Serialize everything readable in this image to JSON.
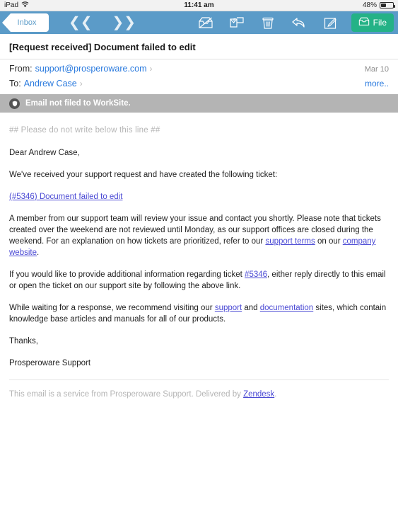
{
  "status_bar": {
    "device": "iPad",
    "wifi_icon": "wifi-icon",
    "time": "11:41 am",
    "battery_percent": "48%",
    "battery_level": 48
  },
  "toolbar": {
    "back_label": "Inbox",
    "prev_icon": "chevron-double-left-icon",
    "next_icon": "chevron-double-right-icon",
    "icons": [
      {
        "name": "mark-unread-icon",
        "label": "Mark as unread"
      },
      {
        "name": "move-to-folder-icon",
        "label": "Move to folder"
      },
      {
        "name": "trash-icon",
        "label": "Delete"
      },
      {
        "name": "reply-icon",
        "label": "Reply"
      },
      {
        "name": "compose-icon",
        "label": "Compose"
      }
    ],
    "file_button": {
      "label": "File",
      "icon": "file-tray-icon",
      "color": "#24b286"
    },
    "bar_color": "#5b9bc8"
  },
  "message": {
    "subject": "[Request received] Document failed to edit",
    "from_label": "From:",
    "from_value": "support@prosperoware.com",
    "to_label": "To:",
    "to_value": "Andrew Case",
    "date": "Mar 10",
    "more_label": "more..",
    "disclosure_icon": "chevron-right-icon",
    "link_color": "#2a7ade"
  },
  "banner": {
    "icon": "shield-icon",
    "text": "Email not filed to WorkSite.",
    "background": "#b4b4b4"
  },
  "body": {
    "separator_note": "## Please do not write below this line ##",
    "greeting": "Dear Andrew Case,",
    "intro": "We've received your support request and have created the following ticket:",
    "ticket_link": "(#5346) Document failed to edit",
    "para2_a": "A member from our support team will review your issue and contact you shortly. Please note that tickets created over the weekend are not reviewed until Monday, as our support offices are closed during the weekend. For an explanation on how tickets are prioritized, refer to our ",
    "para2_link1": "support terms",
    "para2_b": " on our ",
    "para2_link2": "company website",
    "para2_c": ".",
    "para3_a": "If you would like to provide additional information regarding ticket ",
    "para3_link": "#5346",
    "para3_b": ", either reply directly to this email or open the ticket on our support site by following the above link.",
    "para4_a": "While waiting for a response, we recommend visiting our ",
    "para4_link1": "support",
    "para4_b": " and ",
    "para4_link2": "documentation",
    "para4_c": " sites, which contain knowledge base articles and manuals for all of our products.",
    "thanks": "Thanks,",
    "signature": "Prosperoware Support",
    "footer_a": "This email is a service from Prosperoware Support. Delivered by ",
    "footer_link": "Zendesk",
    "footer_b": ".",
    "link_color": "#4a49d4"
  }
}
